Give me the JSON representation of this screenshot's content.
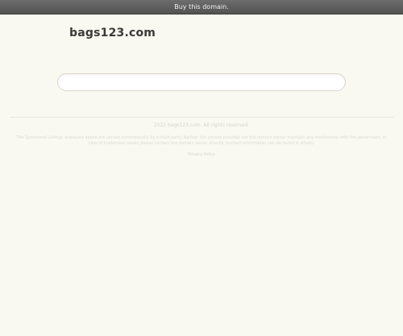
{
  "topbar": {
    "buy_label": "Buy this domain."
  },
  "header": {
    "domain_name": "bags123.com"
  },
  "search": {
    "value": ""
  },
  "footer": {
    "copyright": "2022 bags123.com. All rights reserved.",
    "disclaimer": "The Sponsored Listings displayed above are served automatically by a third party. Neither the service provider nor the domain owner maintain any relationship with the advertisers. In case of trademark issues please contact the domain owner directly (contact information can be found in whois).",
    "privacy_label": "Privacy Policy"
  }
}
